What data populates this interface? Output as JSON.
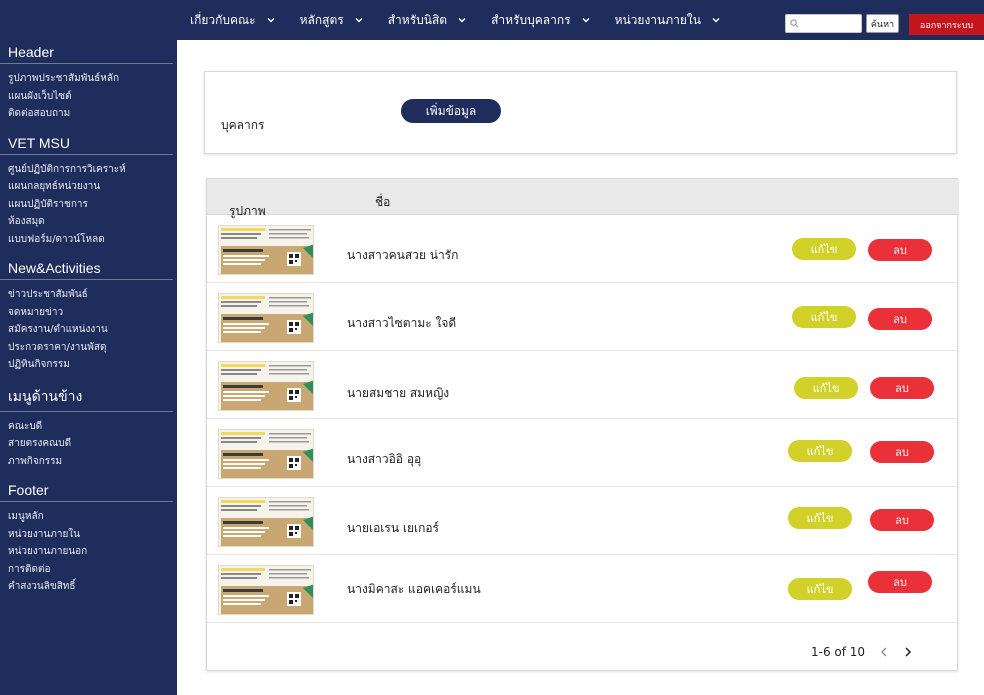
{
  "topnav": {
    "items": [
      {
        "label": "เกี่ยวกับคณะ"
      },
      {
        "label": "หลักสูตร"
      },
      {
        "label": "สำหรับนิสิต"
      },
      {
        "label": "สำหรับบุคลากร"
      },
      {
        "label": "หน่วยงานภายใน"
      }
    ],
    "search_button": "ค้นหา",
    "logout_button": "ออกจากระบบ"
  },
  "sidebar": {
    "sections": [
      {
        "title": "Header",
        "items": [
          "รูปภาพประชาสัมพันธ์หลัก",
          "แผนผังเว็บไซต์",
          "ติดต่อสอบถาม"
        ]
      },
      {
        "title": "VET MSU",
        "items": [
          "ศูนย์ปฏิบัติการการวิเคราะห์",
          "แผนกลยุทธ์หน่วยงาน",
          "แผนปฏิบัติราชการ",
          "ห้องสมุด",
          "แบบฟอร์ม/ดาวน์โหลด"
        ]
      },
      {
        "title": "New&Activities",
        "items": [
          "ข่าวประชาสัมพันธ์",
          "จดหมายข่าว",
          "สมัครงาน/ตำแหน่งงาน",
          "ประกวดราคา/งานพัสดุ",
          "ปฏิทินกิจกรรม"
        ]
      },
      {
        "title": "เมนูด้านข้าง",
        "items": [
          "คณะบดี",
          "สายตรงคณบดี",
          "ภาพกิจกรรม"
        ]
      },
      {
        "title": "Footer",
        "items": [
          "เมนูหลัก",
          "หน่วยงานภายใน",
          "หน่วยงานภายนอก",
          "การติดต่อ",
          "คำสงวนลิขสิทธิ์"
        ]
      }
    ]
  },
  "main": {
    "section_label": "บุคลากร",
    "add_button": "เพิ่มข้อมูล",
    "table": {
      "col_image": "รูปภาพ",
      "col_name": "ชื่อ",
      "rows": [
        {
          "name": "นางสาวคนสวย  น่ารัก",
          "edit": "แก้ไข",
          "delete": "ลบ"
        },
        {
          "name": "นางสาวไซตามะ  ใจดี",
          "edit": "แก้ไข",
          "delete": "ลบ"
        },
        {
          "name": "นายสมชาย  สมหญิง",
          "edit": "แก้ไข",
          "delete": "ลบ"
        },
        {
          "name": "นางสาวอิอิ  อุอุ",
          "edit": "แก้ไข",
          "delete": "ลบ"
        },
        {
          "name": "นายเอเรน  เยเกอร์",
          "edit": "แก้ไข",
          "delete": "ลบ"
        },
        {
          "name": "นางมิคาสะ  แอคเคอร์แมน",
          "edit": "แก้ไข",
          "delete": "ลบ"
        }
      ]
    },
    "pagination": "1-6 of 10"
  },
  "colors": {
    "navy": "#1f2d5c",
    "edit": "#d1d12a",
    "delete": "#ea3038",
    "logout": "#c4161c"
  }
}
